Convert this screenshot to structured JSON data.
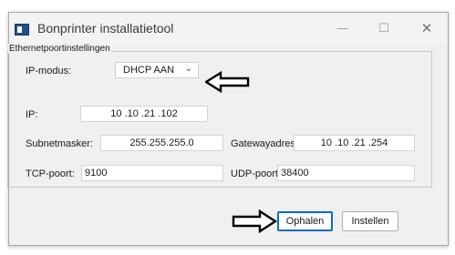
{
  "window": {
    "title": "Bonprinter installatietool",
    "controls": {
      "minimize": "—",
      "maximize": "☐",
      "close": "✕"
    }
  },
  "group": {
    "legend": "Ethernetpoortinstellingen",
    "ip_mode": {
      "label": "IP-modus:",
      "value": "DHCP AAN",
      "chevron": "⌄"
    },
    "ip": {
      "label": "IP:",
      "value": "10 .10 .21 .102"
    },
    "subnet": {
      "label": "Subnetmasker:",
      "value": "255.255.255.0"
    },
    "gateway": {
      "label": "Gatewayadres:",
      "value": "10 .10 .21 .254"
    },
    "tcp": {
      "label": "TCP-poort:",
      "value": "9100"
    },
    "udp": {
      "label": "UDP-poort:",
      "value": "38400"
    }
  },
  "buttons": {
    "fetch": "Ophalen",
    "settings": "Instellen"
  },
  "icons": {
    "pointer_arrows": "hollow-arrow-icon"
  }
}
